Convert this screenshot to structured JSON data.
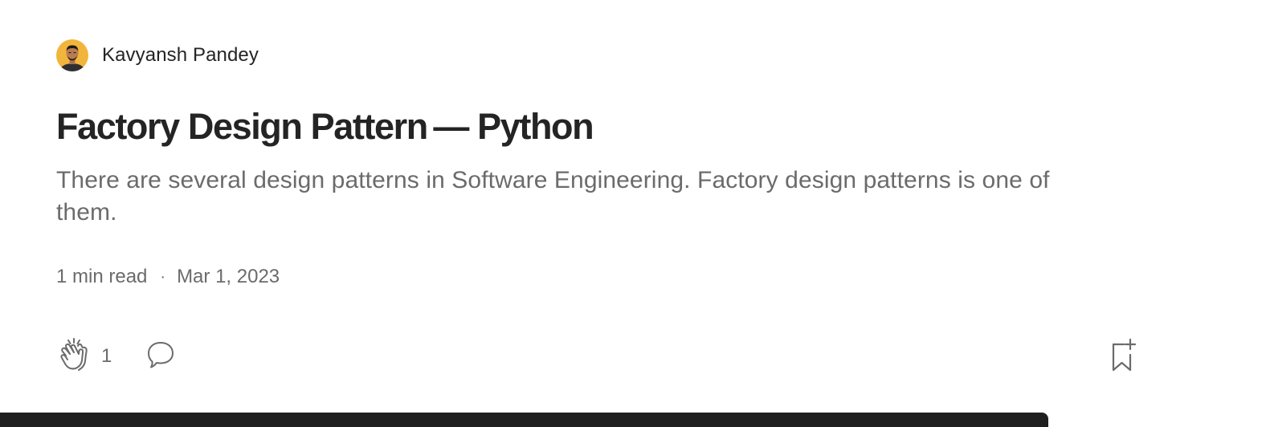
{
  "author": {
    "name": "Kavyansh Pandey"
  },
  "article": {
    "title": "Factory Design Pattern — Python",
    "subtitle": "There are several design patterns in Software Engineering. Factory design patterns is one of them.",
    "read_time": "1 min read",
    "separator": "·",
    "date": "Mar 1, 2023"
  },
  "actions": {
    "clap_count": "1",
    "icons": {
      "clap": "clap-icon",
      "comment": "comment-icon",
      "save": "bookmark-add-icon"
    }
  },
  "status_bar": {
    "url_text": ""
  },
  "colors": {
    "text_primary": "#242424",
    "text_secondary": "#6b6b6b",
    "avatar_bg": "#f2b53c",
    "status_bar_bg": "#1f1f1f"
  }
}
